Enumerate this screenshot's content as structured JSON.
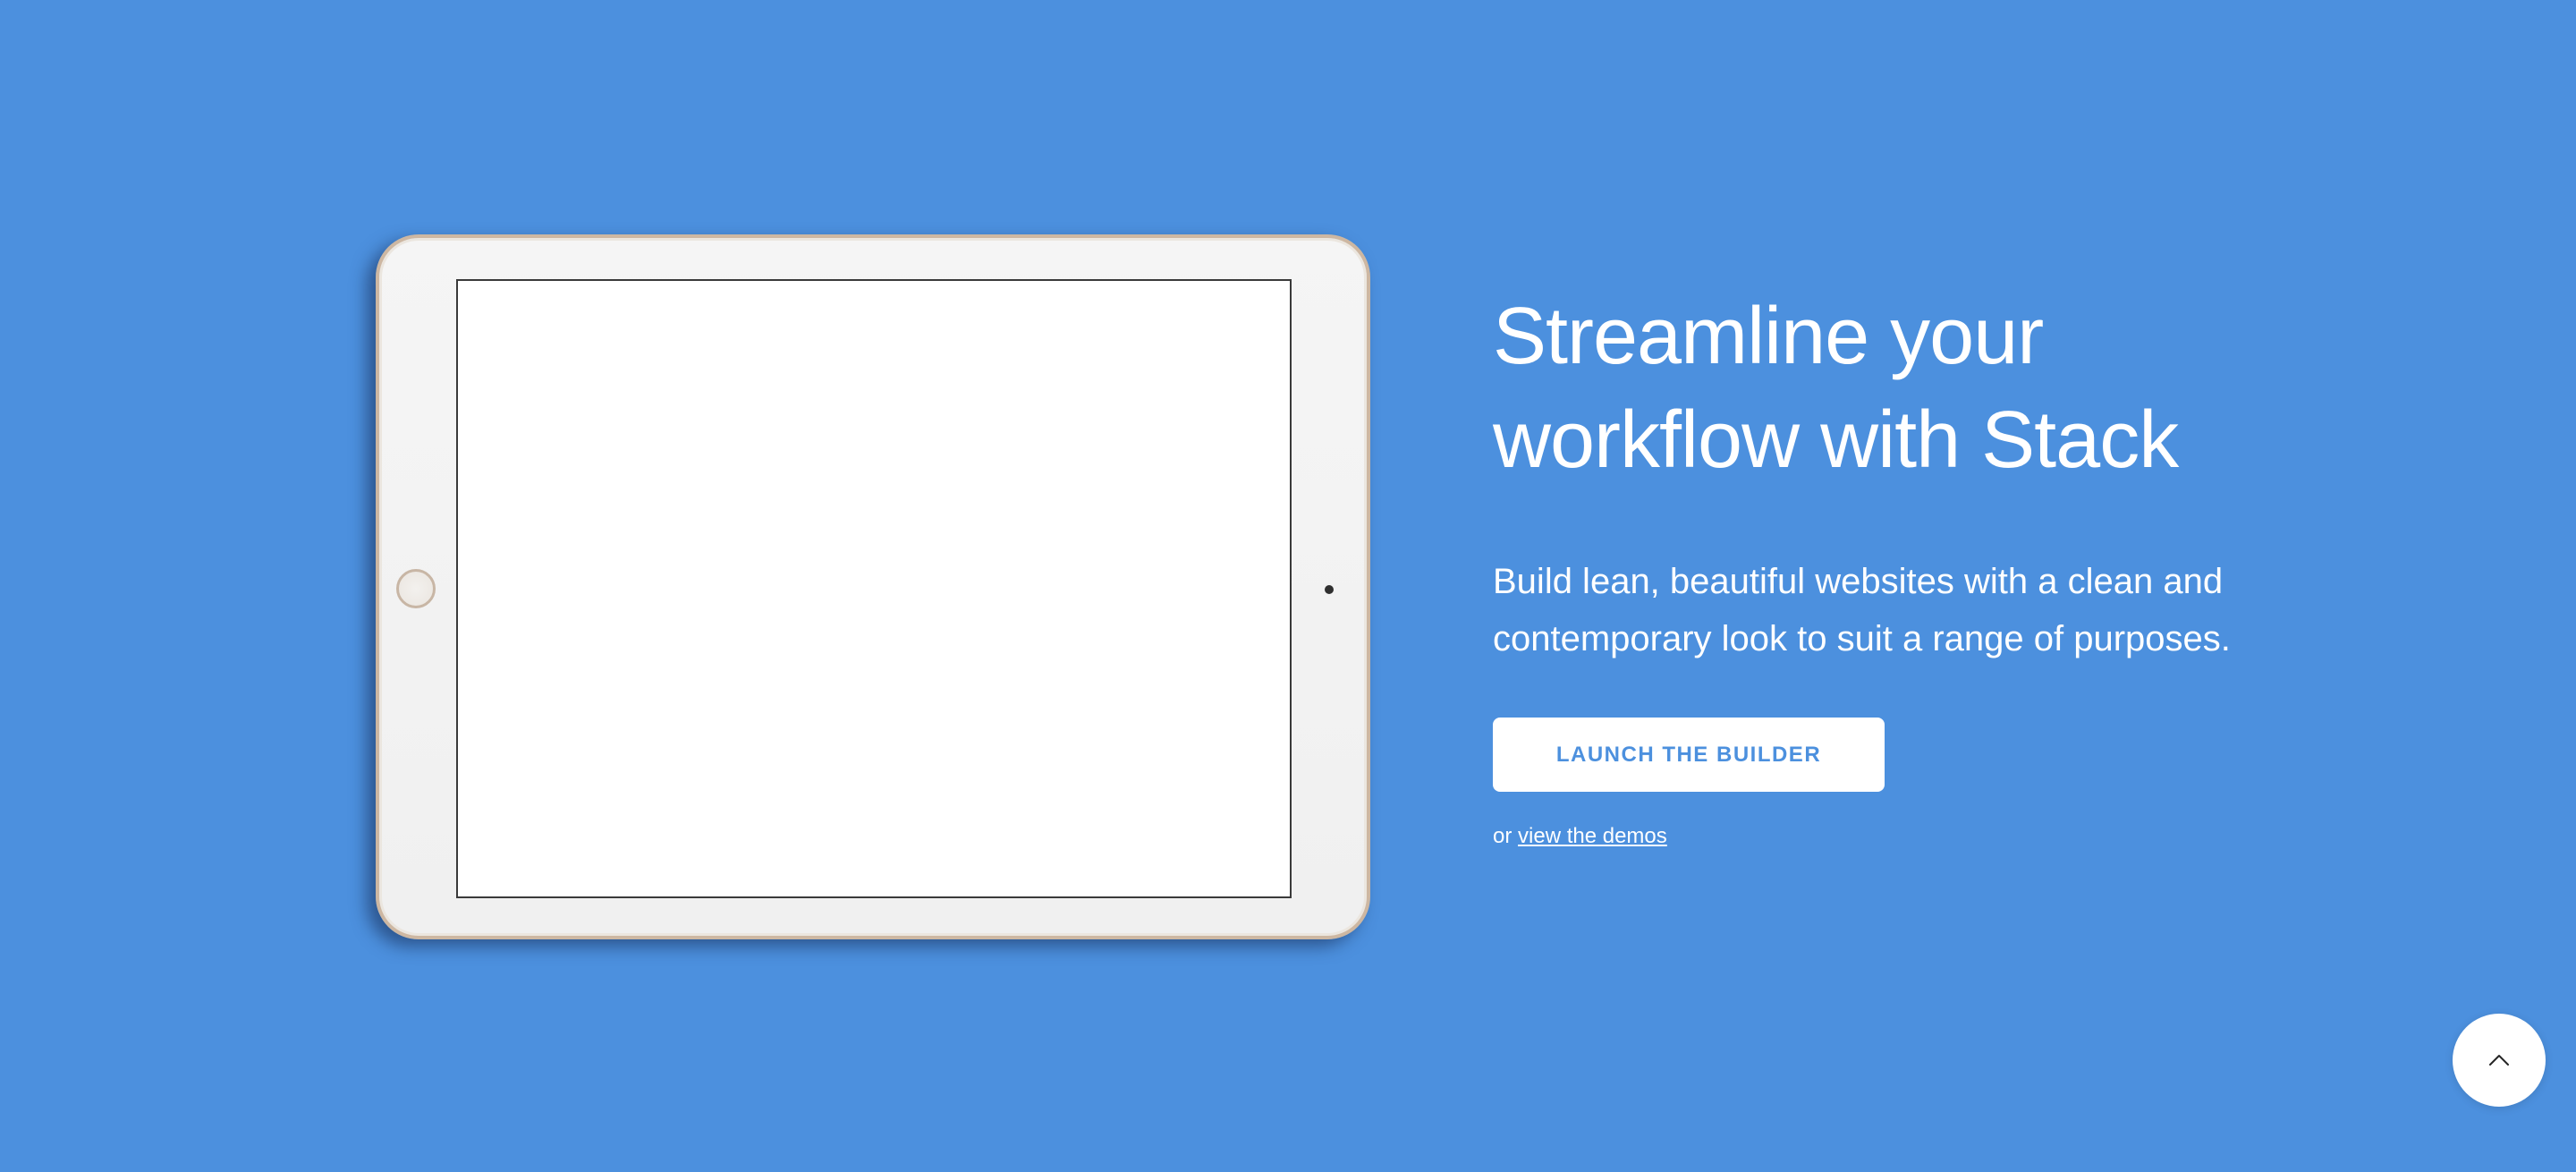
{
  "hero": {
    "headline_line1": "Streamline your",
    "headline_line2": "workflow with Stack",
    "lead_line1": "Build lean, beautiful websites with a clean and",
    "lead_line2": "contemporary look to suit a range of purposes.",
    "cta_label": "LAUNCH THE BUILDER",
    "alt_prefix": "or",
    "alt_link_label": "view the demos"
  },
  "device": {
    "type": "tablet",
    "icons": [
      "home-button-icon",
      "camera-icon"
    ]
  },
  "back_to_top": {
    "icon": "chevron-up-icon"
  },
  "colors": {
    "background": "#4c90de",
    "button_bg": "#ffffff",
    "button_text": "#4c90de",
    "text": "#ffffff"
  }
}
